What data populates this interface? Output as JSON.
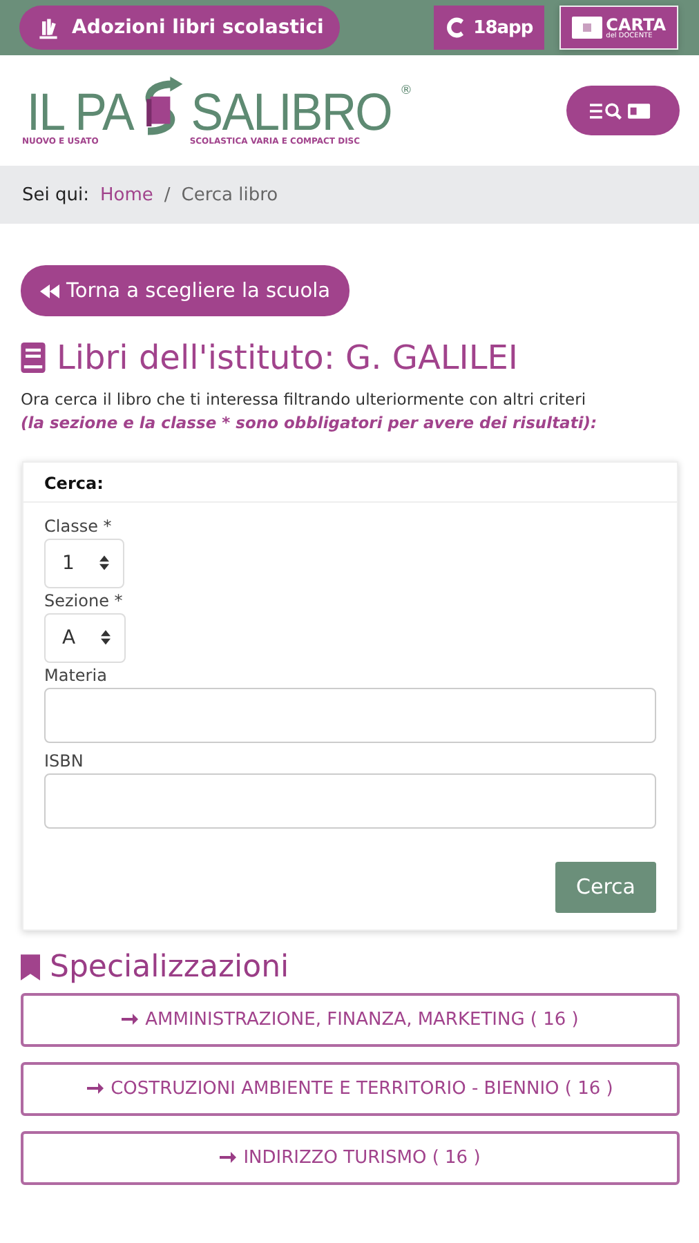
{
  "top_bar": {
    "adoptions_button": "Adozioni libri scolastici",
    "app_badge": "18app",
    "card_badge": {
      "title": "CARTA",
      "subtitle": "del DOCENTE"
    }
  },
  "logo": {
    "left": "IL PA",
    "right": "SALIBRO",
    "mark": "®",
    "tagline_left": "NUOVO E USATO",
    "tagline_right": "SCOLASTICA VARIA E COMPACT DISC"
  },
  "breadcrumb": {
    "label": "Sei qui:",
    "items": [
      {
        "text": "Home",
        "kind": "link"
      },
      {
        "text": "Cerca libro",
        "kind": "current"
      }
    ],
    "separator": "/"
  },
  "back_button": "Torna a scegliere la scuola",
  "heading": "Libri dell'istituto: G. GALILEI",
  "intro": "Ora cerca il libro che ti interessa filtrando ulteriormente con altri criteri",
  "note": "(la sezione e la classe * sono obbligatori per avere dei risultati):",
  "search_card": {
    "title": "Cerca:",
    "fields": [
      {
        "label": "Classe *",
        "kind": "select",
        "value": "1"
      },
      {
        "label": "Sezione *",
        "kind": "select",
        "value": "A"
      },
      {
        "label": "Materia",
        "kind": "text"
      },
      {
        "label": "ISBN",
        "kind": "text"
      }
    ],
    "submit": "Cerca"
  },
  "specializations": {
    "title": "Specializzazioni",
    "items": [
      {
        "text": "AMMINISTRAZIONE, FINANZA, MARKETING ( 16 )"
      },
      {
        "text": "COSTRUZIONI AMBIENTE E TERRITORIO - BIENNIO ( 16 )"
      },
      {
        "text": "INDIRIZZO TURISMO ( 16 )"
      }
    ]
  }
}
